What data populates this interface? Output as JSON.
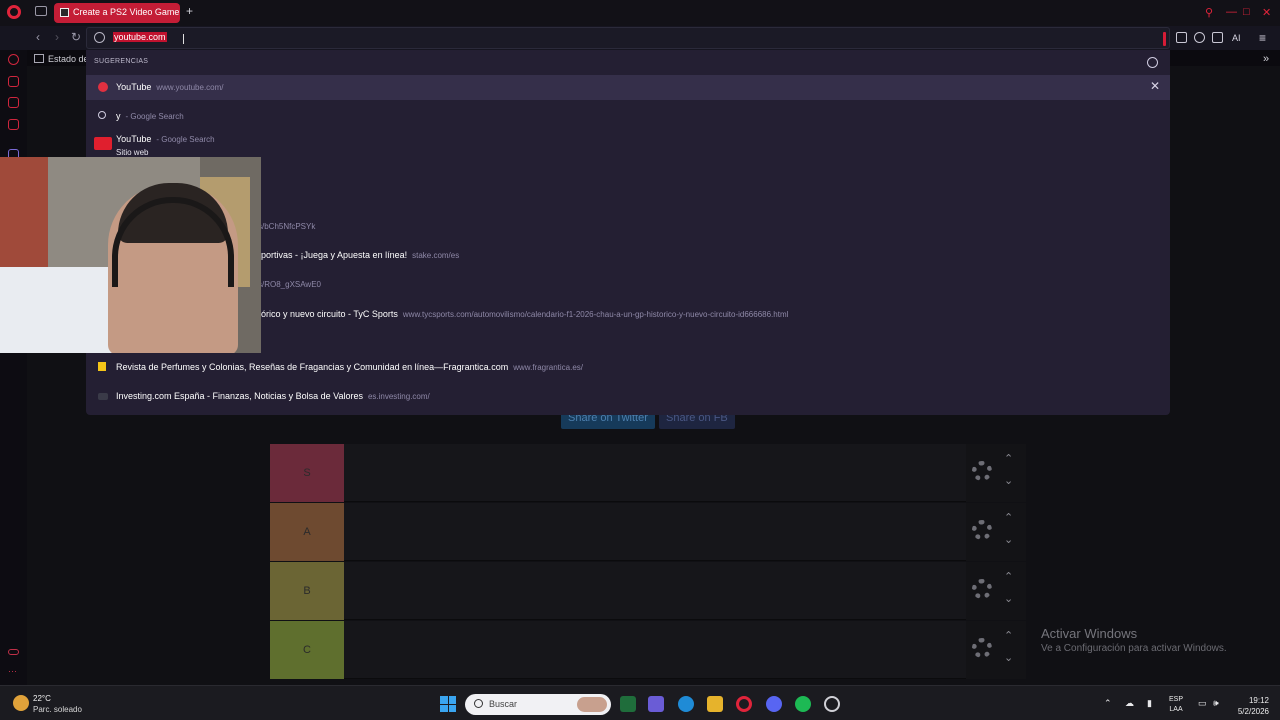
{
  "browser": {
    "tab_title": "Create a PS2 Video Game",
    "new_tab": "+",
    "address_value": "youtube.com",
    "bookmark_label": "Estado de",
    "window_controls": [
      "search-icon",
      "minimize-icon",
      "maximize-icon",
      "close-icon"
    ],
    "toolbar_right": [
      "extensions-icon",
      "profile-icon",
      "download-icon",
      "ai-icon",
      "menu-icon"
    ],
    "ai_label": "AI"
  },
  "suggestions": {
    "heading": "SUGERENCIAS",
    "items": [
      {
        "title": "YouTube",
        "url": "www.youtube.com/"
      },
      {
        "title": "y",
        "url": "- Google Search"
      },
      {
        "title": "YouTube",
        "url": "- Google Search",
        "sub": "Sitio web"
      },
      {
        "title": "",
        "url": "s/bCh5NfcPSYk"
      },
      {
        "title": "portivas - ¡Juega y Apuesta en línea!",
        "url": "stake.com/es"
      },
      {
        "title": "",
        "url": "s/RO8_gXSAwE0"
      },
      {
        "title": "órico y nuevo circuito - TyC Sports",
        "url": "www.tycsports.com/automovilismo/calendario-f1-2026-chau-a-un-gp-historico-y-nuevo-circuito-id666686.html"
      },
      {
        "title": "Revista de Perfumes y Colonias, Reseñas de Fragancias y Comunidad en línea—Fragrantica.com",
        "url": "www.fragrantica.es/"
      },
      {
        "title": "Investing.com España - Finanzas, Noticias y Bolsa de Valores",
        "url": "es.investing.com/"
      }
    ]
  },
  "page": {
    "share_twitter": "Share on Twitter",
    "share_fb": "Share on FB",
    "tiers": [
      {
        "label": "S",
        "color": "#6b2a3a"
      },
      {
        "label": "A",
        "color": "#6e4a30"
      },
      {
        "label": "B",
        "color": "#6b6534"
      },
      {
        "label": "C",
        "color": "#5f6f2e"
      }
    ]
  },
  "watermark": {
    "title": "Activar Windows",
    "subtitle": "Ve a Configuración para activar Windows."
  },
  "taskbar": {
    "temperature": "22°C",
    "weather": "Parc. soleado",
    "search_placeholder": "Buscar",
    "lang_line1": "ESP",
    "lang_line2": "LAA",
    "time": "19:12",
    "date": "5/2/2026"
  },
  "colors": {
    "accent": "#c41d36",
    "dropdown_bg": "#241f33"
  }
}
